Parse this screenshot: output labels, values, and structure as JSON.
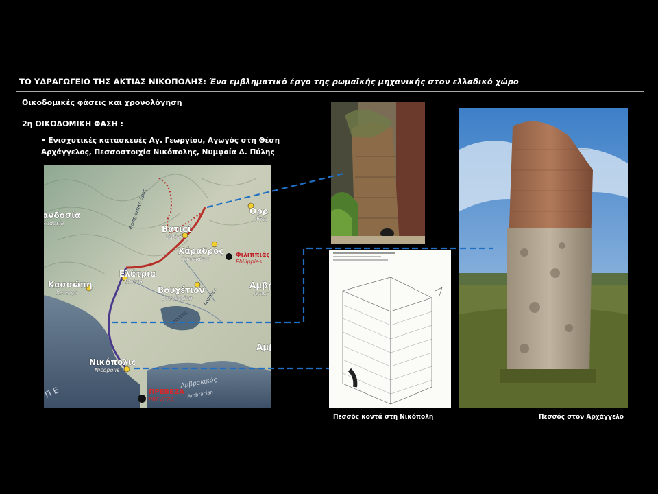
{
  "header": {
    "title_main": "ΤΟ ΥΔΡΑΓΩΓΕΙΟ ΤΗΣ ΑΚΤΙΑΣ ΝΙΚΟΠΟΛΗΣ: ",
    "title_sub": "Ένα εμβληματικό έργο της ρωμαϊκής μηχανικής στον ελλαδικό χώρο"
  },
  "section": {
    "heading": "Οικοδομικές φάσεις και χρονολόγηση",
    "phase": "2η ΟΙΚΟΔΟΜΙΚΗ ΦΑΣΗ :",
    "bullet": "• Ενισχυτικές κατασκευές Αγ. Γεωργίου, Αγωγός στη Θέση Αρχάγγελος, Πεσσοστοιχία Νικόπολης, Νυμφαία Δ. Πύλης"
  },
  "map_labels": {
    "vatiai": "Βατιαί",
    "vatiai_lat": "Vatiai",
    "charadros": "Χάραδρος",
    "charadros_lat": "Charadros",
    "filippias": "Φιλιππιάς",
    "filippias_lat": "Philippias",
    "elatria": "Ελάτρια",
    "elatria_lat": "Elatria",
    "kassopi": "Κασσώπη",
    "kassopi_lat": "Kassopi",
    "vouchetion": "Βουχέτιον",
    "vouchetion_lat": "Vouchetion",
    "nikopolis": "Νικόπολις",
    "nikopolis_lat": "Nicopolis",
    "preveza": "ΠΡΕΒΕΖΑ",
    "preveza_lat": "PREVEZA",
    "orraon": "Ορρ",
    "orraon_lat": "Orrai",
    "amvrakia": "Αμβρ",
    "amvrakia_lat": "Amvr",
    "amvr2": "Αμβρ",
    "pandosia": "ανδοσία",
    "pandosia_lat": "andosia",
    "gulf": "Αμβρακικός",
    "gulf_lat": "Ambracian",
    "sea": "Π Ε",
    "louros": "Louros r.",
    "river2": "Λούρος",
    "thesprotiko": "Θεσπρωτικό όρος"
  },
  "captions": {
    "pier_nikopoli": "Πεσσός κοντά στη Νικόπολη",
    "pier_archangelos": "Πεσσός στον Αρχάγγελο"
  },
  "colors": {
    "leader_line": "#1f6fc4",
    "aqueduct_red": "#b8302a",
    "aqueduct_purple": "#4b3a8c",
    "site_dot": "#f2cf2e"
  }
}
